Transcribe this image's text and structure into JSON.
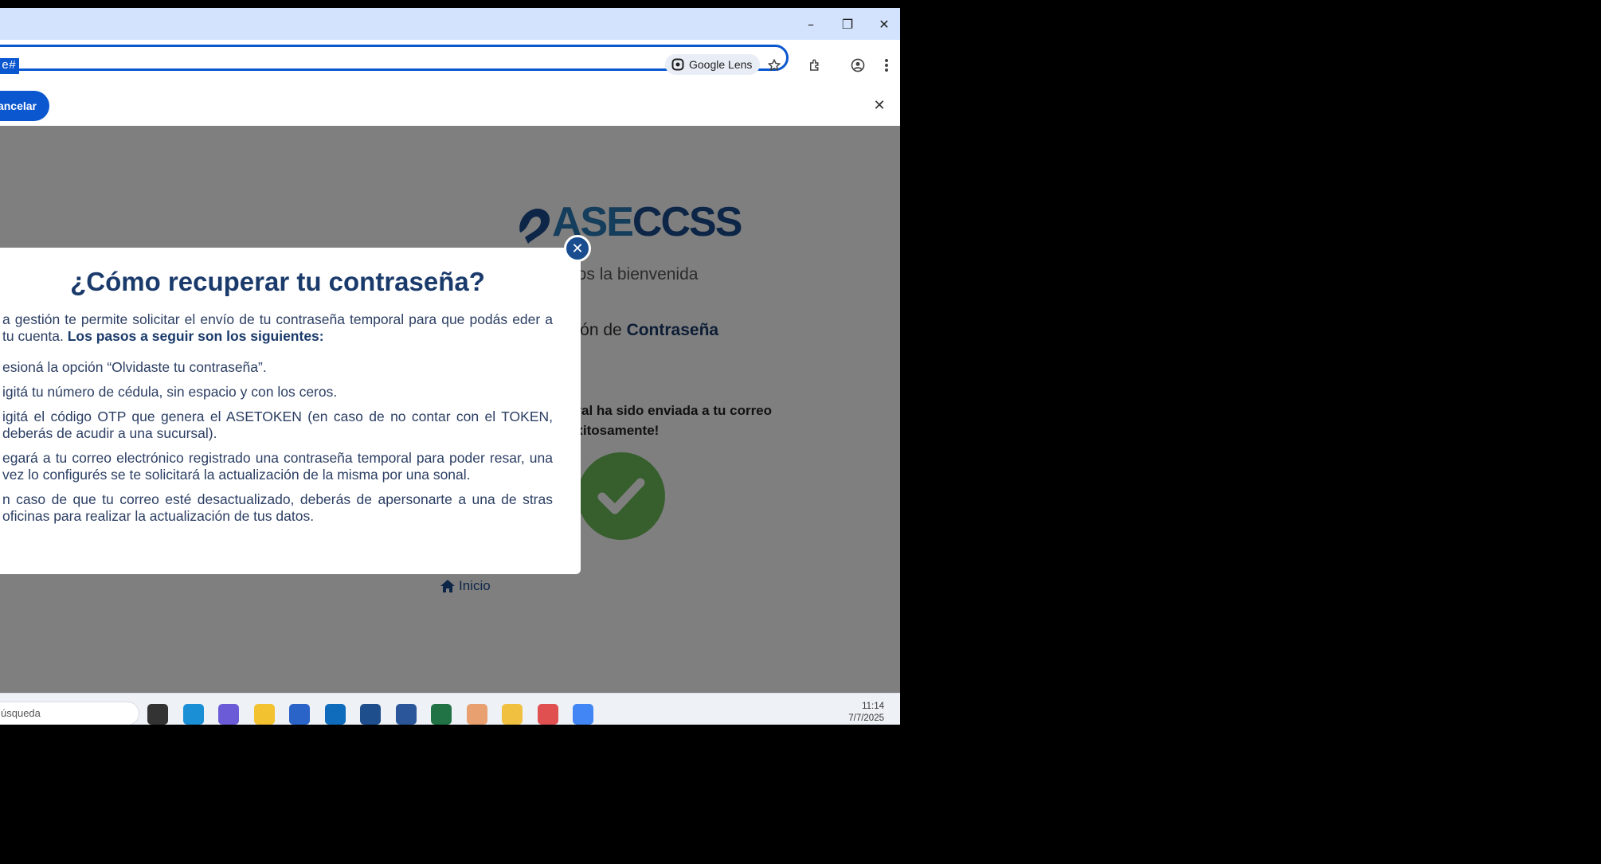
{
  "browser": {
    "url_fragment": "e#",
    "lens_label": "Google Lens",
    "minimize_symbol": "–",
    "restore_symbol": "❐",
    "close_symbol": "✕"
  },
  "infobar": {
    "cancel_label": "Cancelar",
    "close_symbol": "✕"
  },
  "page": {
    "logo_text_a": "ASE",
    "logo_text_b": "CCSS",
    "welcome": "nos la bienvenida",
    "recovery_prefix": "ción de ",
    "recovery_bold": "Contraseña",
    "success_line1": "oral ha sido enviada a tu correo",
    "success_line2": "exitosamente!",
    "inicio_label": "Inicio"
  },
  "modal": {
    "title": "¿Cómo recuperar tu contraseña?",
    "intro": "a gestión te permite solicitar el envío de tu contraseña temporal para que podás eder a tu cuenta. ",
    "intro_bold": "Los pasos a seguir son los siguientes:",
    "steps": [
      "esioná la opción “Olvidaste tu contraseña”.",
      "igitá tu número de cédula, sin espacio y con los ceros.",
      "igitá el código OTP que genera el ASETOKEN (en caso de no contar con el TOKEN, deberás de acudir a una sucursal).",
      "egará a tu correo electrónico registrado una contraseña temporal para poder resar, una vez lo configurés se te solicitará la actualización de la misma por una sonal.",
      "n caso de que tu correo esté desactualizado, deberás de apersonarte a una de stras oficinas para realizar la actualización de tus datos."
    ],
    "close_symbol": "✕"
  },
  "taskbar": {
    "search_placeholder": "úsqueda",
    "time": "11:14",
    "date": "7/7/2025",
    "apps": [
      {
        "name": "task-view-icon",
        "color": "#333333"
      },
      {
        "name": "edge-icon",
        "color": "#1a8fd6"
      },
      {
        "name": "m365-icon",
        "color": "#6b5bd6"
      },
      {
        "name": "file-explorer-icon",
        "color": "#f2c230"
      },
      {
        "name": "store-icon",
        "color": "#2b64c8"
      },
      {
        "name": "outlook-icon",
        "color": "#0f6cbd"
      },
      {
        "name": "azure-icon",
        "color": "#1f4e8c"
      },
      {
        "name": "word-icon",
        "color": "#2b579a"
      },
      {
        "name": "excel-icon",
        "color": "#217346"
      },
      {
        "name": "teams-people-icon",
        "color": "#e8a070"
      },
      {
        "name": "tools-icon",
        "color": "#f0c040"
      },
      {
        "name": "snipping-tool-icon",
        "color": "#e05050"
      },
      {
        "name": "chrome-icon",
        "color": "#4285f4"
      }
    ]
  }
}
